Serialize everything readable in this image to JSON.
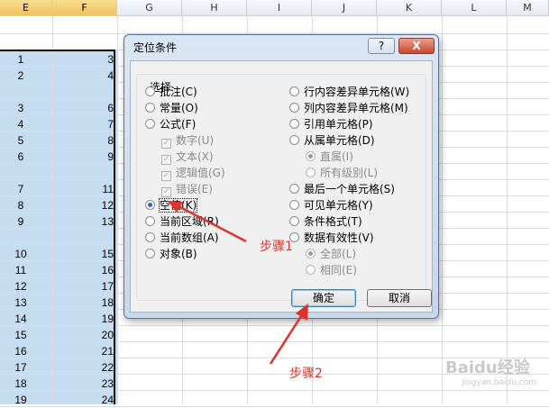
{
  "columns": [
    {
      "label": "E",
      "selected": true
    },
    {
      "label": "F",
      "selected": true
    },
    {
      "label": "G",
      "selected": false
    },
    {
      "label": "H",
      "selected": false
    },
    {
      "label": "I",
      "selected": false
    },
    {
      "label": "J",
      "selected": false
    },
    {
      "label": "K",
      "selected": false
    },
    {
      "label": "L",
      "selected": false
    },
    {
      "label": "M",
      "selected": false
    }
  ],
  "rows": [
    {
      "e": "1",
      "f": "3"
    },
    {
      "e": "2",
      "f": "4"
    },
    {
      "e": "",
      "f": ""
    },
    {
      "e": "3",
      "f": "6"
    },
    {
      "e": "4",
      "f": "7"
    },
    {
      "e": "5",
      "f": "8"
    },
    {
      "e": "6",
      "f": "9"
    },
    {
      "e": "",
      "f": ""
    },
    {
      "e": "7",
      "f": "11"
    },
    {
      "e": "8",
      "f": "12"
    },
    {
      "e": "9",
      "f": "13"
    },
    {
      "e": "",
      "f": ""
    },
    {
      "e": "10",
      "f": "15"
    },
    {
      "e": "11",
      "f": "16"
    },
    {
      "e": "12",
      "f": "17"
    },
    {
      "e": "13",
      "f": "18"
    },
    {
      "e": "14",
      "f": "19"
    },
    {
      "e": "15",
      "f": "20"
    },
    {
      "e": "16",
      "f": "21"
    },
    {
      "e": "17",
      "f": "22"
    },
    {
      "e": "18",
      "f": "23"
    },
    {
      "e": "19",
      "f": "24"
    }
  ],
  "dialog": {
    "title": "定位条件",
    "help": "?",
    "close": "X",
    "group_label": "选择",
    "left_options": [
      {
        "label": "批注(C)",
        "type": "radio"
      },
      {
        "label": "常量(O)",
        "type": "radio"
      },
      {
        "label": "公式(F)",
        "type": "radio"
      },
      {
        "label": "数字(U)",
        "type": "check"
      },
      {
        "label": "文本(X)",
        "type": "check"
      },
      {
        "label": "逻辑值(G)",
        "type": "check"
      },
      {
        "label": "错误(E)",
        "type": "check"
      },
      {
        "label": "空值(K)",
        "type": "radio",
        "checked": true
      },
      {
        "label": "当前区域(R)",
        "type": "radio"
      },
      {
        "label": "当前数组(A)",
        "type": "radio"
      },
      {
        "label": "对象(B)",
        "type": "radio"
      }
    ],
    "right_options": [
      {
        "label": "行内容差异单元格(W)",
        "type": "radio"
      },
      {
        "label": "列内容差异单元格(M)",
        "type": "radio"
      },
      {
        "label": "引用单元格(P)",
        "type": "radio"
      },
      {
        "label": "从属单元格(D)",
        "type": "radio"
      },
      {
        "label": "直属(I)",
        "type": "radio",
        "checked": true
      },
      {
        "label": "所有级别(L)",
        "type": "radio"
      },
      {
        "label": "最后一个单元格(S)",
        "type": "radio"
      },
      {
        "label": "可见单元格(Y)",
        "type": "radio"
      },
      {
        "label": "条件格式(T)",
        "type": "radio"
      },
      {
        "label": "数据有效性(V)",
        "type": "radio"
      },
      {
        "label": "全部(L)",
        "type": "radio",
        "checked": true
      },
      {
        "label": "相同(E)",
        "type": "radio"
      }
    ],
    "ok_label": "确定",
    "cancel_label": "取消"
  },
  "annotations": {
    "step1": "步骤1",
    "step2": "步骤2",
    "color": "#e0312a"
  },
  "watermark": {
    "logo": "Baidu经验",
    "url": "jingyan.baidu.com"
  },
  "colors": {
    "selection": "#c6dcf1",
    "dialog_frame": "#c7d7ec",
    "radio_dot": "#2a62c9"
  }
}
